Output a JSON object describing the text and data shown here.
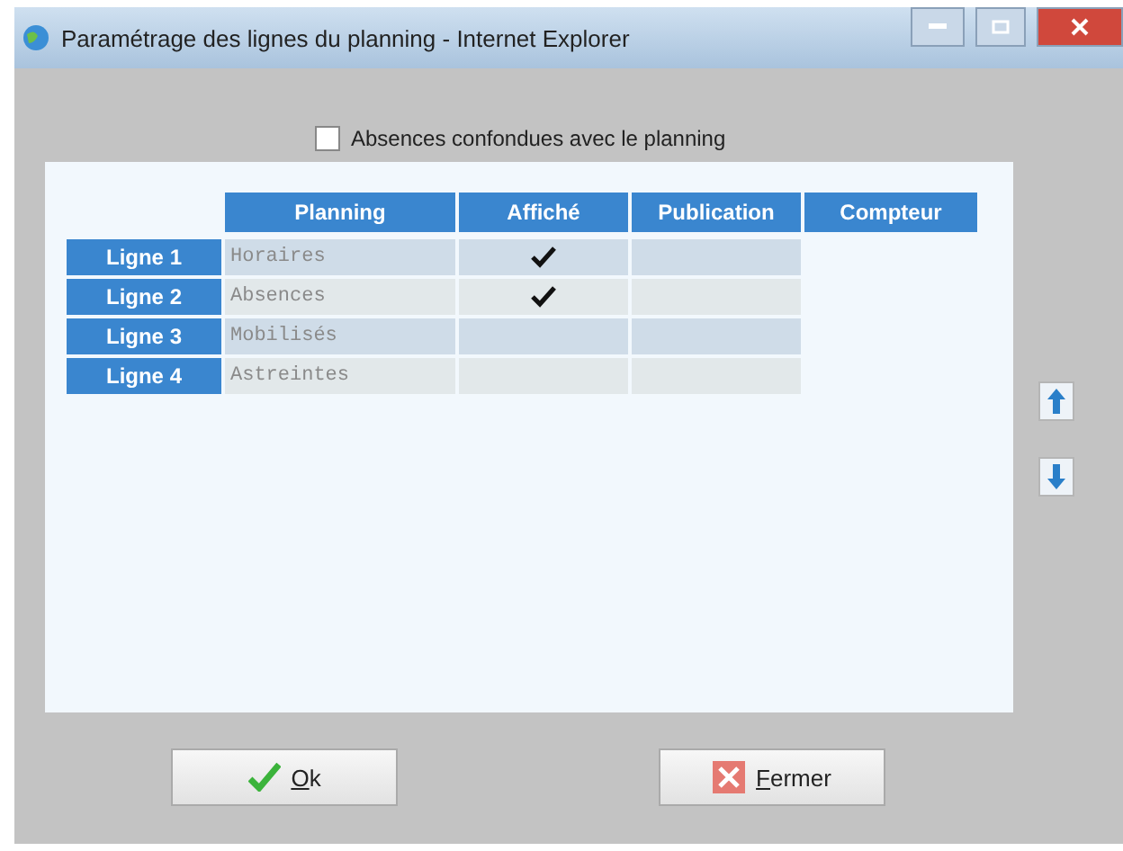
{
  "window": {
    "title": "Paramétrage des lignes du planning - Internet Explorer"
  },
  "option": {
    "label": "Absences confondues avec le planning",
    "checked": false
  },
  "table": {
    "columns": [
      "Planning",
      "Affiché",
      "Publication",
      "Compteur"
    ],
    "rows": [
      {
        "label": "Ligne 1",
        "planning": "Horaires",
        "affiche": true
      },
      {
        "label": "Ligne 2",
        "planning": "Absences",
        "affiche": true
      },
      {
        "label": "Ligne 3",
        "planning": "Mobilisés",
        "affiche": false
      },
      {
        "label": "Ligne 4",
        "planning": "Astreintes",
        "affiche": false
      }
    ]
  },
  "buttons": [
    {
      "kind": "ok",
      "label": "Ok"
    },
    {
      "kind": "close",
      "label": "Fermer"
    }
  ]
}
